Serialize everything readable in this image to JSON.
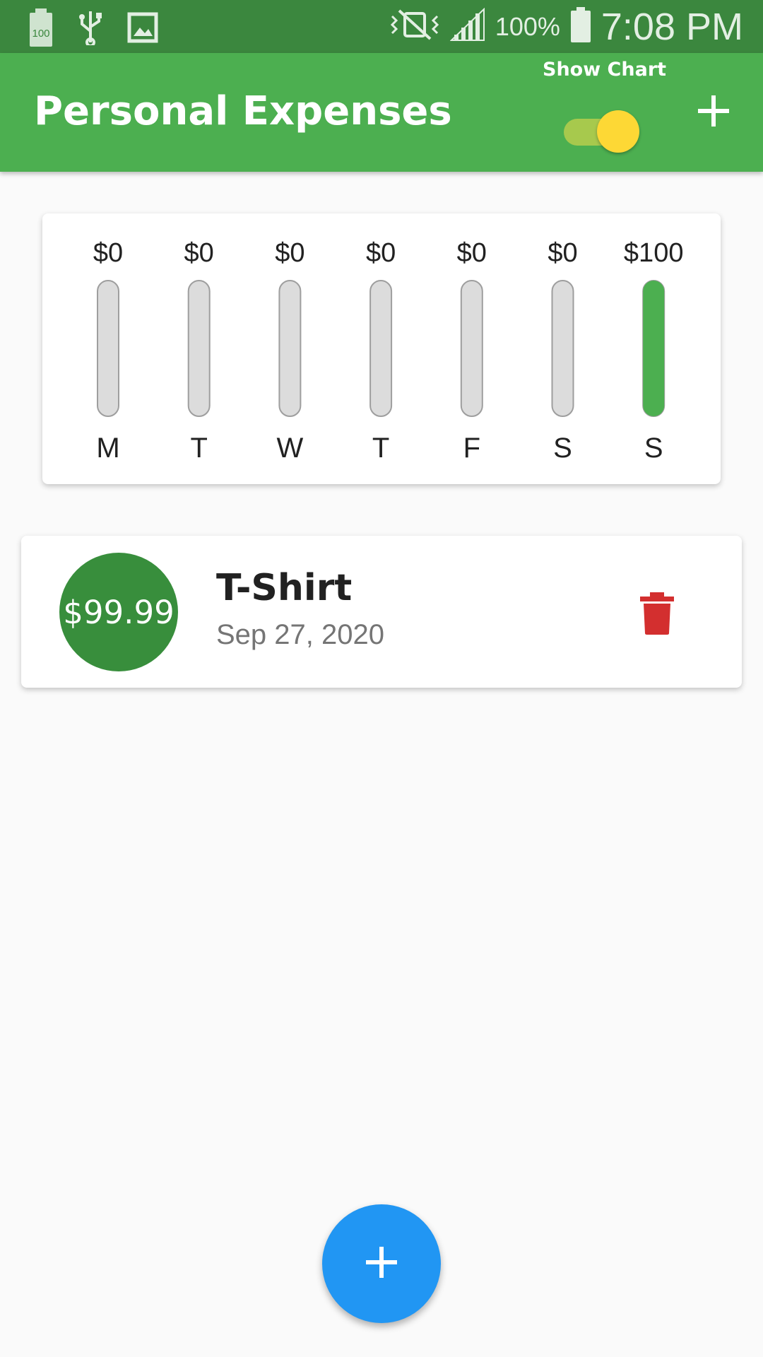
{
  "status_bar": {
    "battery_badge": "100",
    "battery_percent": "100%",
    "time": "7:08 PM",
    "icons": [
      "battery-saver-icon",
      "usb-icon",
      "image-icon",
      "vibrate-off-icon",
      "signal-icon",
      "battery-icon"
    ]
  },
  "app_bar": {
    "title": "Personal Expenses",
    "show_chart_label": "Show Chart",
    "show_chart_enabled": true,
    "add_icon": "plus-icon"
  },
  "chart_data": {
    "type": "bar",
    "categories": [
      "M",
      "T",
      "W",
      "T",
      "F",
      "S",
      "S"
    ],
    "values": [
      0,
      0,
      0,
      0,
      0,
      0,
      100
    ],
    "value_labels": [
      "$0",
      "$0",
      "$0",
      "$0",
      "$0",
      "$0",
      "$100"
    ],
    "spending_fraction": [
      0,
      0,
      0,
      0,
      0,
      0,
      1
    ],
    "title": "",
    "xlabel": "",
    "ylabel": "",
    "colors": {
      "fill": "#4caf50",
      "track": "#dcdcdc",
      "track_border": "#9e9e9e"
    }
  },
  "transactions": [
    {
      "amount": "$99.99",
      "title": "T-Shirt",
      "date": "Sep 27, 2020",
      "delete_icon": "trash-icon"
    }
  ],
  "fab": {
    "icon": "plus-icon"
  },
  "colors": {
    "status_bar": "#3b873e",
    "primary": "#4caf50",
    "avatar": "#388e3c",
    "accent": "#fdd835",
    "delete": "#d32f2f",
    "fab": "#2196f3"
  }
}
